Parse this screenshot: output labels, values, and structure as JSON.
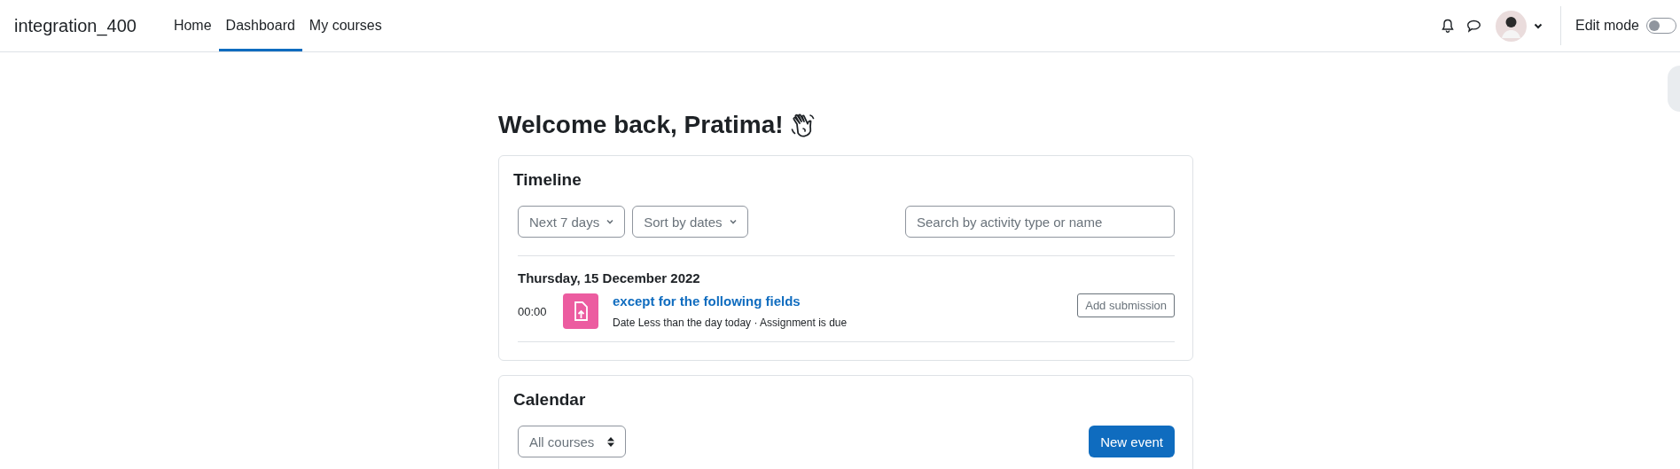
{
  "navbar": {
    "site_name": "integration_400",
    "links": [
      {
        "label": "Home",
        "selected": false
      },
      {
        "label": "Dashboard",
        "selected": true
      },
      {
        "label": "My courses",
        "selected": false
      }
    ],
    "edit_mode": {
      "label": "Edit mode",
      "on": false
    }
  },
  "heading": "Welcome back, Pratima!",
  "timeline": {
    "title": "Timeline",
    "filters": [
      "Next 7 days",
      "Sort by dates"
    ],
    "search": {
      "placeholder": "Search by activity type or name"
    },
    "groups": [
      {
        "date": "Thursday, 15 December 2022",
        "events": [
          {
            "time": "00:00",
            "name": "except for the following fields",
            "details": "Date Less than the day today · Assignment is due",
            "action": "Add submission"
          }
        ]
      }
    ]
  },
  "calendar": {
    "title": "Calendar",
    "course_filter": "All courses",
    "new_event": "New event"
  }
}
